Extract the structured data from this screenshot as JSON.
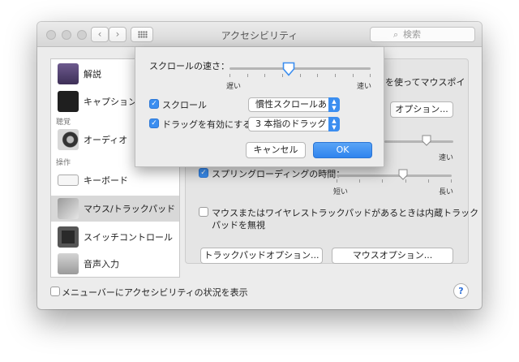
{
  "window": {
    "title": "アクセシビリティ",
    "search_placeholder": "検索",
    "nav_back": "‹",
    "nav_forward": "›"
  },
  "sidebar": {
    "items": [
      {
        "label": "解説",
        "icon": "description-icon"
      },
      {
        "label": "キャプション",
        "icon": "captions-icon"
      },
      {
        "label": "オーディオ",
        "icon": "speaker-icon"
      },
      {
        "label": "キーボード",
        "icon": "keyboard-icon"
      },
      {
        "label": "マウス/トラックパッド",
        "icon": "mouse-trackpad-icon",
        "selected": true
      },
      {
        "label": "スイッチコントロール",
        "icon": "switch-control-icon"
      },
      {
        "label": "音声入力",
        "icon": "microphone-icon"
      }
    ],
    "section_hearing": "聴覚",
    "section_interaction": "操作"
  },
  "panel": {
    "partial_text": "を使ってマウスポイ",
    "options_button": "オプション...",
    "slider1_right": "速い",
    "spring_loading": {
      "label": "スプリングローディングの時間：",
      "checked": true,
      "min_label": "短い",
      "max_label": "長い",
      "value_fraction": 0.58
    },
    "ignore_builtin": {
      "label_line1": "マウスまたはワイヤレストラックパッドがあるときは内蔵トラック",
      "label_line2": "パッドを無視",
      "checked": false
    },
    "trackpad_options_button": "トラックパッドオプション...",
    "mouse_options_button": "マウスオプション..."
  },
  "bottom": {
    "show_status_label": "メニューバーにアクセシビリティの状況を表示",
    "show_status_checked": false,
    "help": "?"
  },
  "sheet": {
    "scroll_speed_label": "スクロールの速さ：",
    "scroll_speed_min": "遅い",
    "scroll_speed_max": "速い",
    "scroll_speed_fraction": 0.42,
    "scroll": {
      "label": "スクロール",
      "checked": true,
      "select_value": "慣性スクロールあり"
    },
    "drag": {
      "label": "ドラッグを有効にする",
      "checked": true,
      "select_value": "3 本指のドラッグ"
    },
    "cancel_button": "キャンセル",
    "ok_button": "OK"
  },
  "colors": {
    "accent": "#3b8ef0",
    "selected_row": "#d8d8d8"
  }
}
